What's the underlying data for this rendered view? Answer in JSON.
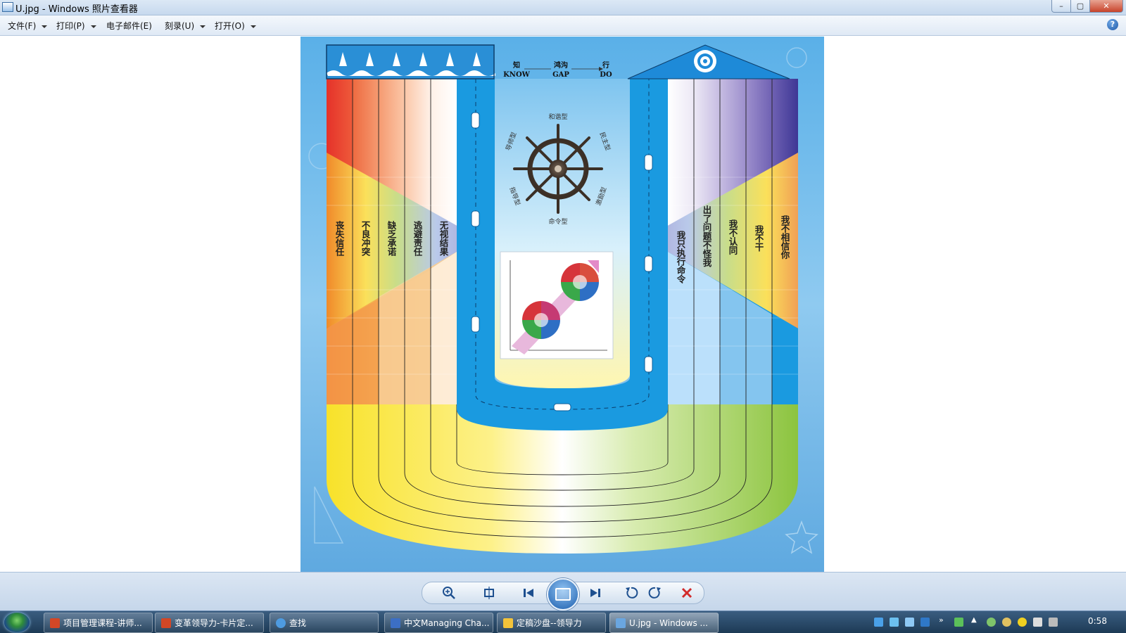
{
  "window": {
    "title": "U.jpg - Windows 照片查看器",
    "controls": {
      "minimize": "–",
      "maximize": "▢",
      "close": "✕"
    }
  },
  "menu": {
    "items": [
      {
        "label": "文件(F)",
        "has_dropdown": true
      },
      {
        "label": "打印(P)",
        "has_dropdown": true
      },
      {
        "label": "电子邮件(E)",
        "has_dropdown": false
      },
      {
        "label": "刻录(U)",
        "has_dropdown": true
      },
      {
        "label": "打开(O)",
        "has_dropdown": true
      }
    ],
    "help_icon": "?"
  },
  "image": {
    "header": {
      "know_cn": "知",
      "know_en": "KNOW",
      "gap_cn": "鸿沟",
      "gap_en": "GAP",
      "do_cn": "行",
      "do_en": "DO"
    },
    "wheel_labels": {
      "top": "和谐型",
      "bottom": "命令型",
      "left_upper": "导师型",
      "left_lower": "指导型",
      "right_upper": "民主型",
      "right_lower": "激励型"
    },
    "left_column_texts": [
      "丧失信任",
      "不良冲突",
      "缺乏承诺",
      "逃避责任",
      "无视结果"
    ],
    "right_column_texts": [
      "我只执行命令",
      "出了问题不怪我",
      "我不认同",
      "我不干",
      "我不相信你"
    ],
    "colors": {
      "sky": "#5fb1e6",
      "river": "#1a9ae0",
      "red": "#e5322a",
      "orange": "#f08a2a",
      "yellow": "#fbe84a",
      "green": "#9dcb52",
      "purple": "#4a40a0"
    }
  },
  "controlbar": {
    "buttons": [
      "zoom-icon",
      "fit-icon",
      "previous-icon",
      "slideshow-icon",
      "next-icon",
      "rotate-left-icon",
      "rotate-right-icon",
      "delete-icon"
    ]
  },
  "taskbar": {
    "tasks": [
      {
        "label": "项目管理课程-讲师...",
        "icon_color": "#d24726",
        "active": false
      },
      {
        "label": "变革领导力-卡片定...",
        "icon_color": "#d24726",
        "active": false
      },
      {
        "label": "查找",
        "icon_color": "#4e9be0",
        "active": false
      },
      {
        "label": "中文Managing Cha...",
        "icon_color": "#3c6fc4",
        "active": false
      },
      {
        "label": "定稿沙盘--领导力",
        "icon_color": "#f3c33a",
        "active": false
      },
      {
        "label": "U.jpg - Windows ...",
        "icon_color": "#6aa6e0",
        "active": true
      }
    ],
    "clock": "0:58"
  }
}
